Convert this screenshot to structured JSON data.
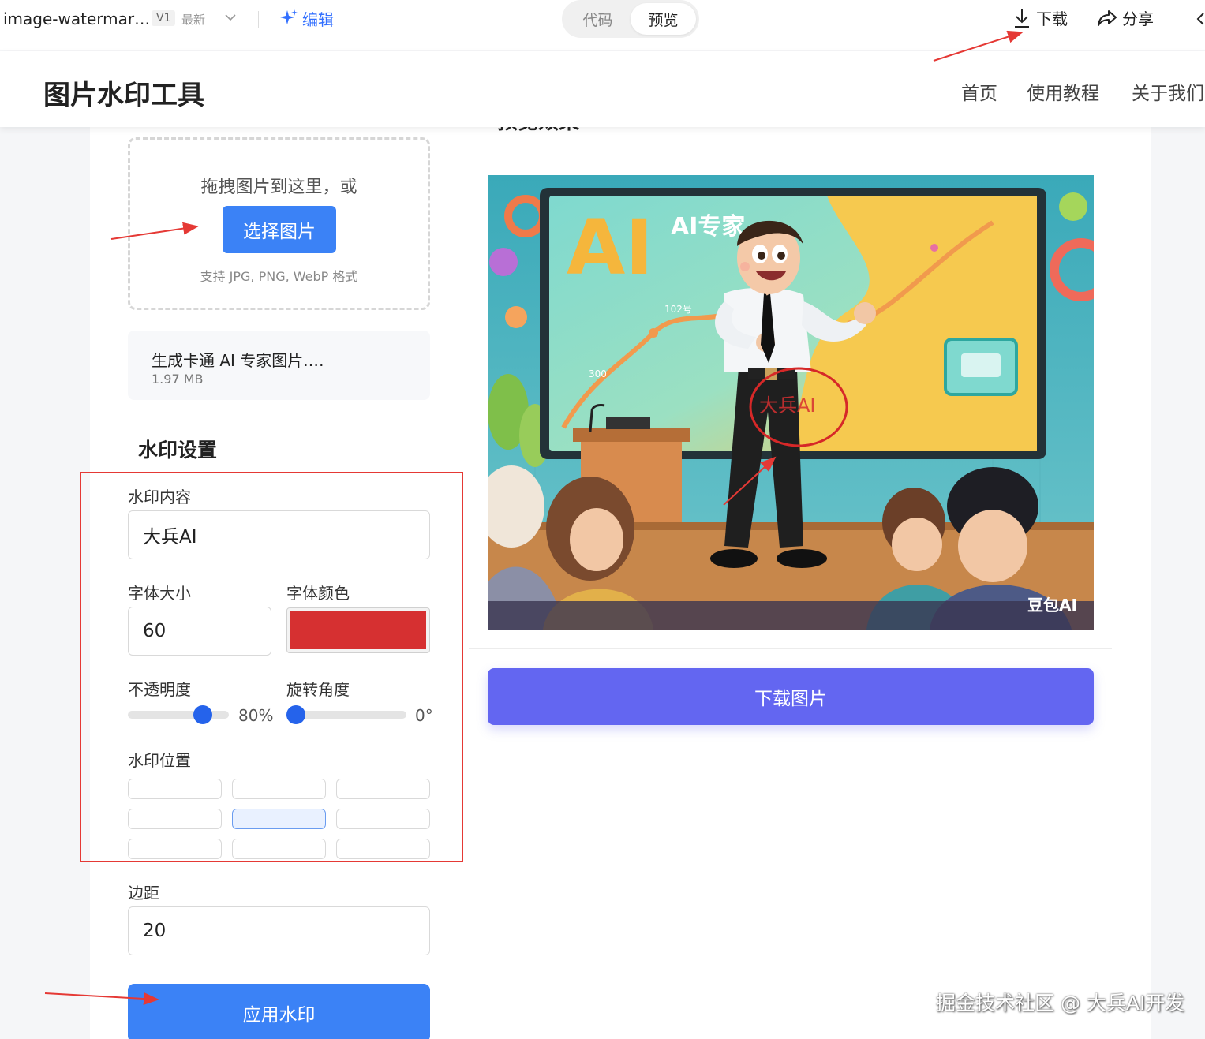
{
  "topbar": {
    "doc_title": "image-watermar…",
    "version": "V1",
    "latest": "最新",
    "edit_label": "编辑",
    "view_tabs": [
      "代码",
      "预览"
    ],
    "active_tab": "预览",
    "download_label": "下载",
    "share_label": "分享"
  },
  "header": {
    "site_title": "图片水印工具",
    "nav": [
      "首页",
      "使用教程",
      "关于我们"
    ]
  },
  "upload": {
    "drop_text": "拖拽图片到这里，或",
    "choose_button": "选择图片",
    "formats_hint": "支持 JPG, PNG, WebP 格式"
  },
  "file": {
    "name": "生成卡通 AI 专家图片.…",
    "size": "1.97 MB"
  },
  "settings": {
    "title": "水印设置",
    "content_label": "水印内容",
    "content_value": "大兵AI",
    "font_size_label": "字体大小",
    "font_size_value": "60",
    "font_color_label": "字体颜色",
    "font_color_value": "#d63031",
    "opacity_label": "不透明度",
    "opacity_value": "80%",
    "opacity_level": 0.8,
    "rotation_label": "旋转角度",
    "rotation_value": "0°",
    "rotation_level": 0.0,
    "position_label": "水印位置",
    "positions": [
      "top-left",
      "top-center",
      "top-right",
      "middle-left",
      "center",
      "middle-right",
      "bottom-left",
      "bottom-center",
      "bottom-right"
    ],
    "selected_position": "center",
    "margin_label": "边距",
    "margin_value": "20",
    "apply_button": "应用水印"
  },
  "preview": {
    "section_title_cut": "预览效果",
    "image_board_heading": "AI",
    "image_board_sub": "AI专家",
    "watermark_text": "大兵AI",
    "image_corner_mark": "豆包AI",
    "image_chart_numbers": [
      "300",
      "102号"
    ],
    "download_button": "下载图片"
  },
  "footer": {
    "community_watermark": "掘金技术社区 @ 大兵AI开发"
  },
  "colors": {
    "primary_blue": "#3b82f6",
    "indigo": "#6366f1",
    "annotation_red": "#e53935",
    "watermark_red": "#d63031"
  }
}
